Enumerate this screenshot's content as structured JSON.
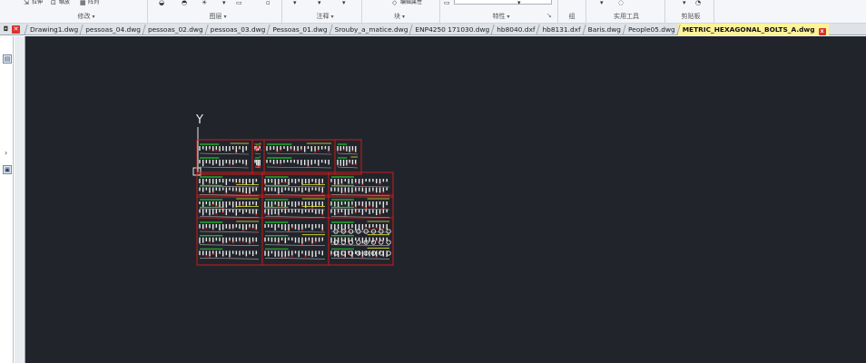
{
  "ribbon": {
    "groups": [
      {
        "label": "修改",
        "dropdown": "▾"
      },
      {
        "label": "图层",
        "dropdown": "▾"
      },
      {
        "label": "注释",
        "dropdown": "▾"
      },
      {
        "label": "块",
        "dropdown": "▾"
      },
      {
        "label": "特性",
        "dropdown": "▾"
      },
      {
        "label": "组",
        "dropdown": ""
      },
      {
        "label": "实用工具",
        "dropdown": ""
      },
      {
        "label": "剪贴板",
        "dropdown": ""
      }
    ],
    "fragments": {
      "modify_a": "拉伸",
      "modify_b": "缩放",
      "modify_c": "阵列",
      "block": "编辑属性"
    },
    "launcher": "↘"
  },
  "file_tabs": {
    "items": [
      "Drawing1.dwg",
      "pessoas_04.dwg",
      "pessoas_02.dwg",
      "pessoas_03.dwg",
      "Pessoas_01.dwg",
      "Srouby_a_matice.dwg",
      "ENP4250 171030.dwg",
      "hb8040.dxf",
      "hb8131.dxf",
      "Baris.dwg",
      "People05.dwg",
      "METRIC_HEXAGONAL_BOLTS_A.dwg"
    ],
    "active": "METRIC_HEXAGONAL_BOLTS_A.dwg",
    "close_glyph": "x"
  },
  "left_panel": {
    "arrow": "›"
  },
  "canvas": {
    "ucs_axis_label": "Y",
    "colors": {
      "background": "#21252b",
      "frame": "#cc1a1a",
      "drawing": "#e8e8e8",
      "highlight": "#22c12a",
      "accent": "#e8e832"
    }
  }
}
